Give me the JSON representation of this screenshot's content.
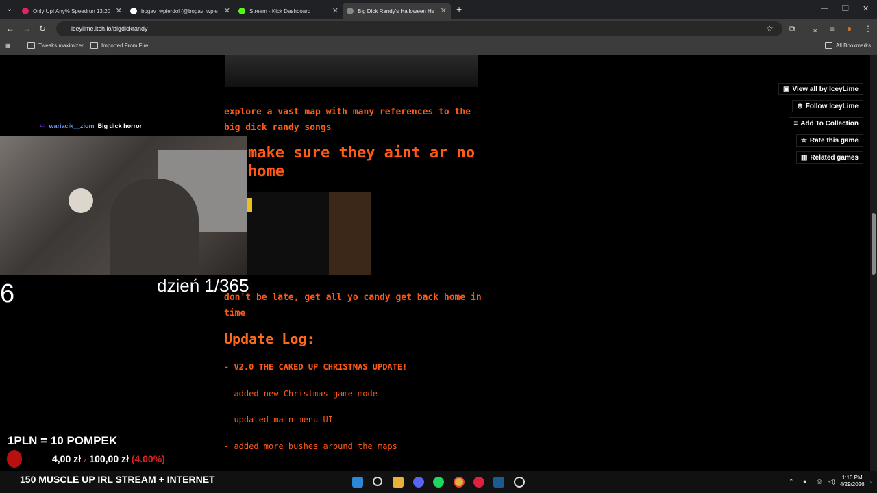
{
  "browser": {
    "tabs": [
      {
        "label": "Only Up! Any% Speedrun 13:20",
        "color": "#e0245e"
      },
      {
        "label": "bogav_wpierdol (@bogav_wpie",
        "color": "#000000"
      },
      {
        "label": "Stream - Kick Dashboard",
        "color": "#53fc18"
      },
      {
        "label": "Big Dick Randy's Halloween He",
        "color": "#888888"
      }
    ],
    "url": "iceylime.itch.io/bigdickrandy",
    "bookmarks": [
      "Tweaks maximizer",
      "Imported From Fire...",
      "All Bookmarks"
    ]
  },
  "page": {
    "intro": "explore a vast map with many references to the big dick randy songs",
    "heading": "make sure they aint ar no home",
    "text2": "don't be late, get all yo candy get back home in time",
    "update_heading": "Update Log:",
    "log": [
      "- V2.0 THE CAKED UP CHRISTMAS UPDATE!",
      "- added new Christmas game mode",
      "- updated main menu UI",
      "- added more bushes around the maps"
    ],
    "sidebar": [
      {
        "label": "View all by IceyLime",
        "icon": "store-icon"
      },
      {
        "label": "Follow IceyLime",
        "icon": "user-plus-icon"
      },
      {
        "label": "Add To Collection",
        "icon": "list-add-icon"
      },
      {
        "label": "Rate this game",
        "icon": "star-icon"
      },
      {
        "label": "Related games",
        "icon": "book-icon"
      }
    ]
  },
  "overlay": {
    "chat_user": "wariacik__ziom",
    "chat_message": "Big dick horror",
    "day": "dzień 1/365",
    "counter": "6",
    "pln": "1PLN = 10 POMPEK",
    "donation_current": "4,00 zł",
    "donation_sep": "z",
    "donation_goal": "100,00 zł",
    "donation_pct": "(4.00%)",
    "stream_title": "150 MUSCLE UP IRL STREAM + INTERNET"
  },
  "taskbar": {
    "time": "1:10 PM",
    "date": "4/29/2026"
  }
}
